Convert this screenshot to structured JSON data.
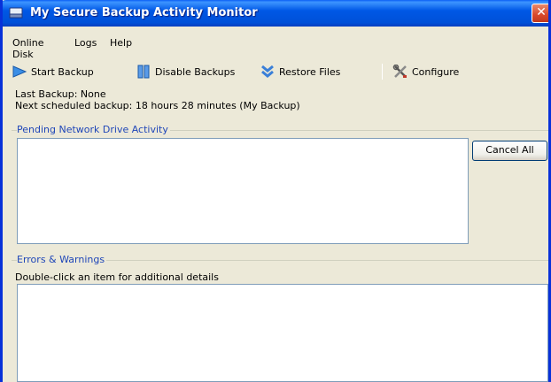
{
  "window": {
    "title": "My Secure Backup Activity Monitor",
    "close_label": "✕"
  },
  "menu": {
    "items": [
      {
        "label": "Online Disk"
      },
      {
        "label": "Logs"
      },
      {
        "label": "Help"
      }
    ]
  },
  "toolbar": {
    "start_backup": "Start Backup",
    "disable_backups": "Disable Backups",
    "restore_files": "Restore Files",
    "configure": "Configure"
  },
  "status": {
    "last_backup": "Last Backup: None",
    "next_backup": "Next scheduled backup: 18 hours 28 minutes (My Backup)"
  },
  "pending": {
    "title": "Pending Network Drive Activity",
    "cancel_all": "Cancel All"
  },
  "errors": {
    "title": "Errors & Warnings",
    "hint": "Double-click an item for additional details"
  },
  "colors": {
    "titlebar": "#0058E6",
    "group_title": "#1F46B8",
    "window_bg": "#ECE9D8"
  }
}
